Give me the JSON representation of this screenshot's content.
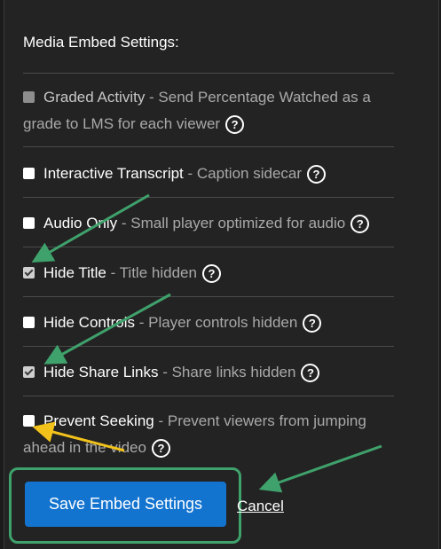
{
  "heading": "Media Embed Settings:",
  "options": [
    {
      "label": "Graded Activity",
      "desc": " - Send Percentage Watched as a",
      "desc2": "grade to LMS for each viewer",
      "checked": false,
      "disabled": true
    },
    {
      "label": "Interactive Transcript",
      "desc": " - Caption sidecar",
      "checked": false
    },
    {
      "label": "Audio Only",
      "desc": " - Small player optimized for audio",
      "checked": false
    },
    {
      "label": "Hide Title",
      "desc": " - Title hidden",
      "checked": true
    },
    {
      "label": "Hide Controls",
      "desc": " - Player controls hidden",
      "checked": false
    },
    {
      "label": "Hide Share Links",
      "desc": " - Share links hidden",
      "checked": true
    },
    {
      "label": "Prevent Seeking",
      "desc": " - Prevent viewers from jumping",
      "desc2": "ahead in the video",
      "checked": false
    }
  ],
  "help_glyph": "?",
  "save_label": "Save Embed Settings",
  "cancel_label": "Cancel",
  "colors": {
    "accent": "#1374d0",
    "annotation_green": "#3fa16b",
    "annotation_yellow": "#f2c21b"
  }
}
